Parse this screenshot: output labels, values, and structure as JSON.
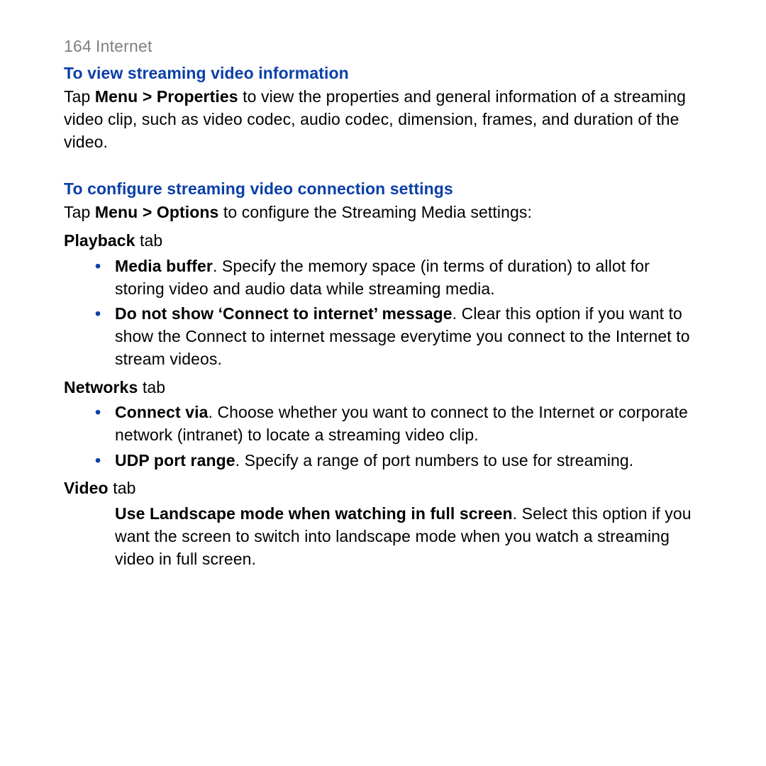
{
  "header": {
    "page_number": "164",
    "section": "Internet"
  },
  "sec1": {
    "heading": "To view streaming video information",
    "p_pre": "Tap ",
    "p_bold": "Menu > Properties",
    "p_post": " to view the properties and general information of a streaming video clip, such as video codec, audio codec, dimension, frames, and duration of the video."
  },
  "sec2": {
    "heading": "To configure streaming video connection settings",
    "intro_pre": "Tap ",
    "intro_bold": "Menu > Options",
    "intro_post": " to configure the Streaming Media settings:",
    "playback": {
      "label_bold": "Playback",
      "label_rest": " tab",
      "items": [
        {
          "bold": "Media buffer",
          "rest": ". Specify the memory space (in terms of duration) to allot for storing video and audio data while streaming media."
        },
        {
          "bold": "Do not show ‘Connect to internet’ message",
          "rest": ". Clear this option if you want to show the Connect to internet message everytime you connect to the Internet to stream videos."
        }
      ]
    },
    "networks": {
      "label_bold": "Networks",
      "label_rest": " tab",
      "items": [
        {
          "bold": "Connect via",
          "rest": ". Choose whether you want to connect to the Internet or corporate network (intranet) to locate a streaming video clip."
        },
        {
          "bold": "UDP port range",
          "rest": ". Specify a range of port numbers to use for streaming."
        }
      ]
    },
    "video": {
      "label_bold": "Video",
      "label_rest": " tab",
      "item_bold": "Use Landscape mode when watching in full screen",
      "item_rest": ". Select this option if you want the screen to switch into landscape mode when you watch a streaming video in full screen."
    }
  }
}
